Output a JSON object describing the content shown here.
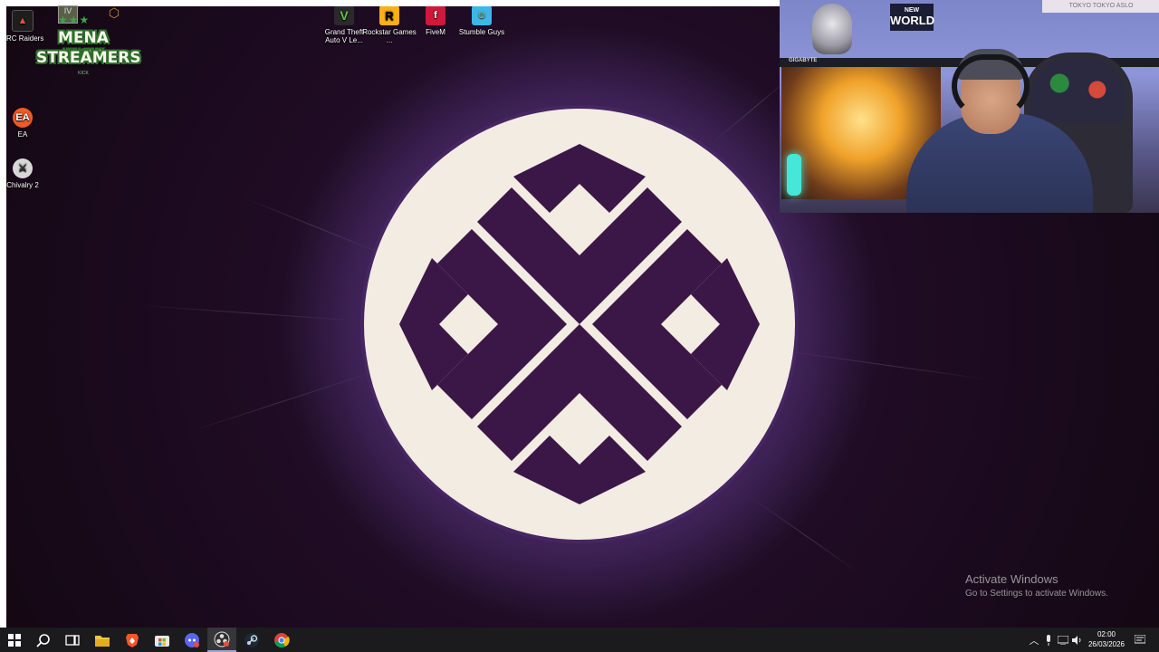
{
  "desktop_icons": [
    {
      "id": "arc-raiders",
      "label": "ARC Raiders"
    },
    {
      "id": "ea",
      "label": "EA"
    },
    {
      "id": "chivalry-2",
      "label": "Chivalry 2"
    },
    {
      "id": "gta5",
      "label": "Grand Theft Auto V Le..."
    },
    {
      "id": "rockstar",
      "label": "Rockstar Games ..."
    },
    {
      "id": "fivem",
      "label": "FiveM"
    },
    {
      "id": "stumble-guys",
      "label": "Stumble Guys"
    }
  ],
  "overlay_badge": {
    "line1": "MENA KICK",
    "line2": "STREAMERS",
    "small_text": "KICK"
  },
  "watermark": {
    "title": "Activate Windows",
    "subtitle": "Go to Settings to activate Windows."
  },
  "webcam": {
    "shelf_label": "GIGABYTE",
    "poster_text_top": "NEW",
    "poster_text_bottom": "WORLD",
    "sign_text": "TOKYO TOKYO ASLO"
  },
  "taskbar": {
    "pinned": [
      "start",
      "search",
      "task-view",
      "file-explorer",
      "brave",
      "store",
      "discord",
      "obs-studio",
      "steam",
      "chrome"
    ],
    "active": "obs-studio"
  },
  "clock": {
    "time": "02:00",
    "date": "26/03/2026"
  },
  "colors": {
    "wallpaper": "#1d0b22",
    "logo_fill": "#3b1747",
    "logo_ring": "#f3ece2",
    "taskbar": "#1b1b1e"
  }
}
